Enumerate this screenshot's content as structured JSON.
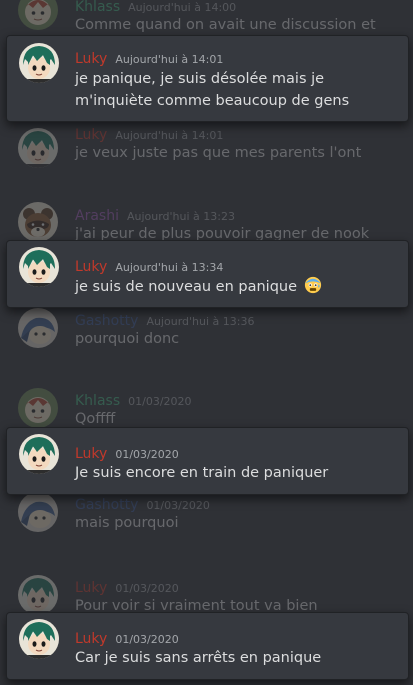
{
  "messages": [
    {
      "author": "Khlass",
      "color": "#43b581",
      "time": "Aujourd'hui à 14:00",
      "lines": [
        "Comme quand on avait une discussion et"
      ],
      "avatar": "khlass",
      "highlight": false
    },
    {
      "author": "Luky",
      "color": "#c0392b",
      "time": "Aujourd'hui à 14:01",
      "lines": [
        "je panique, je suis désolée mais je",
        "m'inquiète comme beaucoup de gens"
      ],
      "avatar": "luky",
      "highlight": true
    },
    {
      "author": "Luky",
      "color": "#c0392b",
      "time": "Aujourd'hui à 14:01",
      "lines": [
        "je veux juste pas que mes parents l'ont"
      ],
      "avatar": "luky",
      "highlight": false
    },
    {
      "author": "Arashi",
      "color": "#9b59b6",
      "time": "Aujourd'hui à 13:23",
      "lines": [
        "j'ai peur de plus pouvoir gagner de nook"
      ],
      "avatar": "arashi",
      "highlight": false
    },
    {
      "author": "Luky",
      "color": "#c0392b",
      "time": "Aujourd'hui à 13:34",
      "lines": [
        "je suis de nouveau en panique"
      ],
      "emoji": "anxious-face-emoji",
      "avatar": "luky",
      "highlight": true
    },
    {
      "author": "Gashotty",
      "color": "#3b5998",
      "time": "Aujourd'hui à 13:36",
      "lines": [
        "pourquoi donc"
      ],
      "avatar": "gashotty",
      "highlight": false
    },
    {
      "author": "Khlass",
      "color": "#43b581",
      "time": "01/03/2020",
      "lines": [
        "Qoffff"
      ],
      "avatar": "khlass",
      "highlight": false
    },
    {
      "author": "Luky",
      "color": "#c0392b",
      "time": "01/03/2020",
      "lines": [
        "Je suis encore en train de paniquer"
      ],
      "avatar": "luky",
      "highlight": true
    },
    {
      "author": "Gashotty",
      "color": "#3b5998",
      "time": "01/03/2020",
      "lines": [
        "mais pourquoi"
      ],
      "avatar": "gashotty",
      "highlight": false
    },
    {
      "author": "Luky",
      "color": "#c0392b",
      "time": "01/03/2020",
      "lines": [
        "Pour voir si vraiment tout va bien"
      ],
      "avatar": "luky",
      "highlight": false
    },
    {
      "author": "Luky",
      "color": "#c0392b",
      "time": "01/03/2020",
      "lines": [
        "Car je suis sans arrêts en panique"
      ],
      "avatar": "luky",
      "highlight": true
    }
  ]
}
